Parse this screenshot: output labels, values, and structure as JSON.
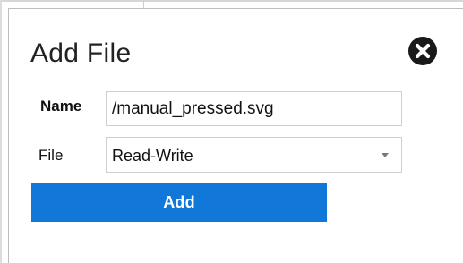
{
  "dialog": {
    "title": "Add File",
    "close_icon": "close-circle-icon"
  },
  "form": {
    "name_label": "Name",
    "name_value": "/manual_pressed.svg",
    "file_label": "File",
    "file_mode_selected": "Read-Write",
    "dropdown_icon": "chevron-down-icon"
  },
  "actions": {
    "add_label": "Add"
  },
  "colors": {
    "primary_button": "#1177d9",
    "close_icon": "#1a1a1a",
    "input_border": "#cfcfcf"
  }
}
